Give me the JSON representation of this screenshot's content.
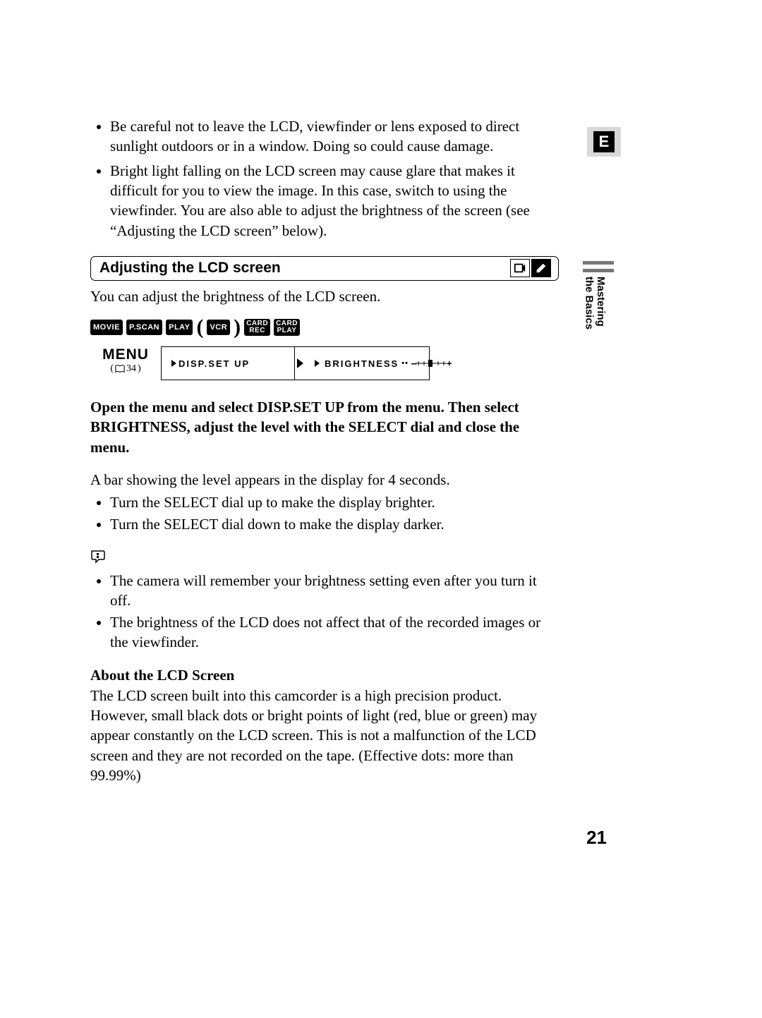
{
  "page_number": "21",
  "e_label": "E",
  "side_tab": {
    "line1": "Mastering",
    "line2": "the Basics"
  },
  "top_bullets": [
    "Be careful not to leave the LCD, viewfinder or lens exposed to direct sunlight outdoors or in a window. Doing so could cause damage.",
    "Bright light falling on the LCD screen may cause glare that makes it difficult for you to view the image. In this case, switch to using the viewfinder. You are also able to adjust the brightness of the screen (see “Adjusting the LCD screen” below)."
  ],
  "section_title": "Adjusting the LCD screen",
  "intro": "You can adjust the brightness of the LCD screen.",
  "modes": {
    "movie": "MOVIE",
    "pscan": "P.SCAN",
    "play": "PLAY",
    "vcr": "VCR",
    "card_rec_top": "CARD",
    "card_rec_bot": "REC",
    "card_play_top": "CARD",
    "card_play_bot": "PLAY"
  },
  "menu": {
    "label": "MENU",
    "ref": "34",
    "box1": "DISP.SET UP",
    "box2": "BRIGHTNESS",
    "slider_minus": "–",
    "slider_plus": "+"
  },
  "instruction": "Open the menu and select DISP.SET UP from the menu. Then select BRIGHTNESS, adjust the level with the SELECT dial and close the menu.",
  "body1": "A bar showing the level appears in the display for 4 seconds.",
  "body_bullets": [
    "Turn the SELECT dial up to make the display brighter.",
    "Turn the SELECT dial down to make the display darker."
  ],
  "note_bullets": [
    "The camera will remember your brightness setting even after you turn it off.",
    "The brightness of the LCD does not affect that of the recorded images or the viewfinder."
  ],
  "about_h": "About the LCD Screen",
  "about_body": "The LCD screen built into this camcorder is a high precision product. However, small black dots or bright points of light (red, blue or green) may appear constantly on the LCD screen. This is not a malfunction of the LCD screen and they are not recorded on the tape. (Effective dots: more than 99.99%)"
}
